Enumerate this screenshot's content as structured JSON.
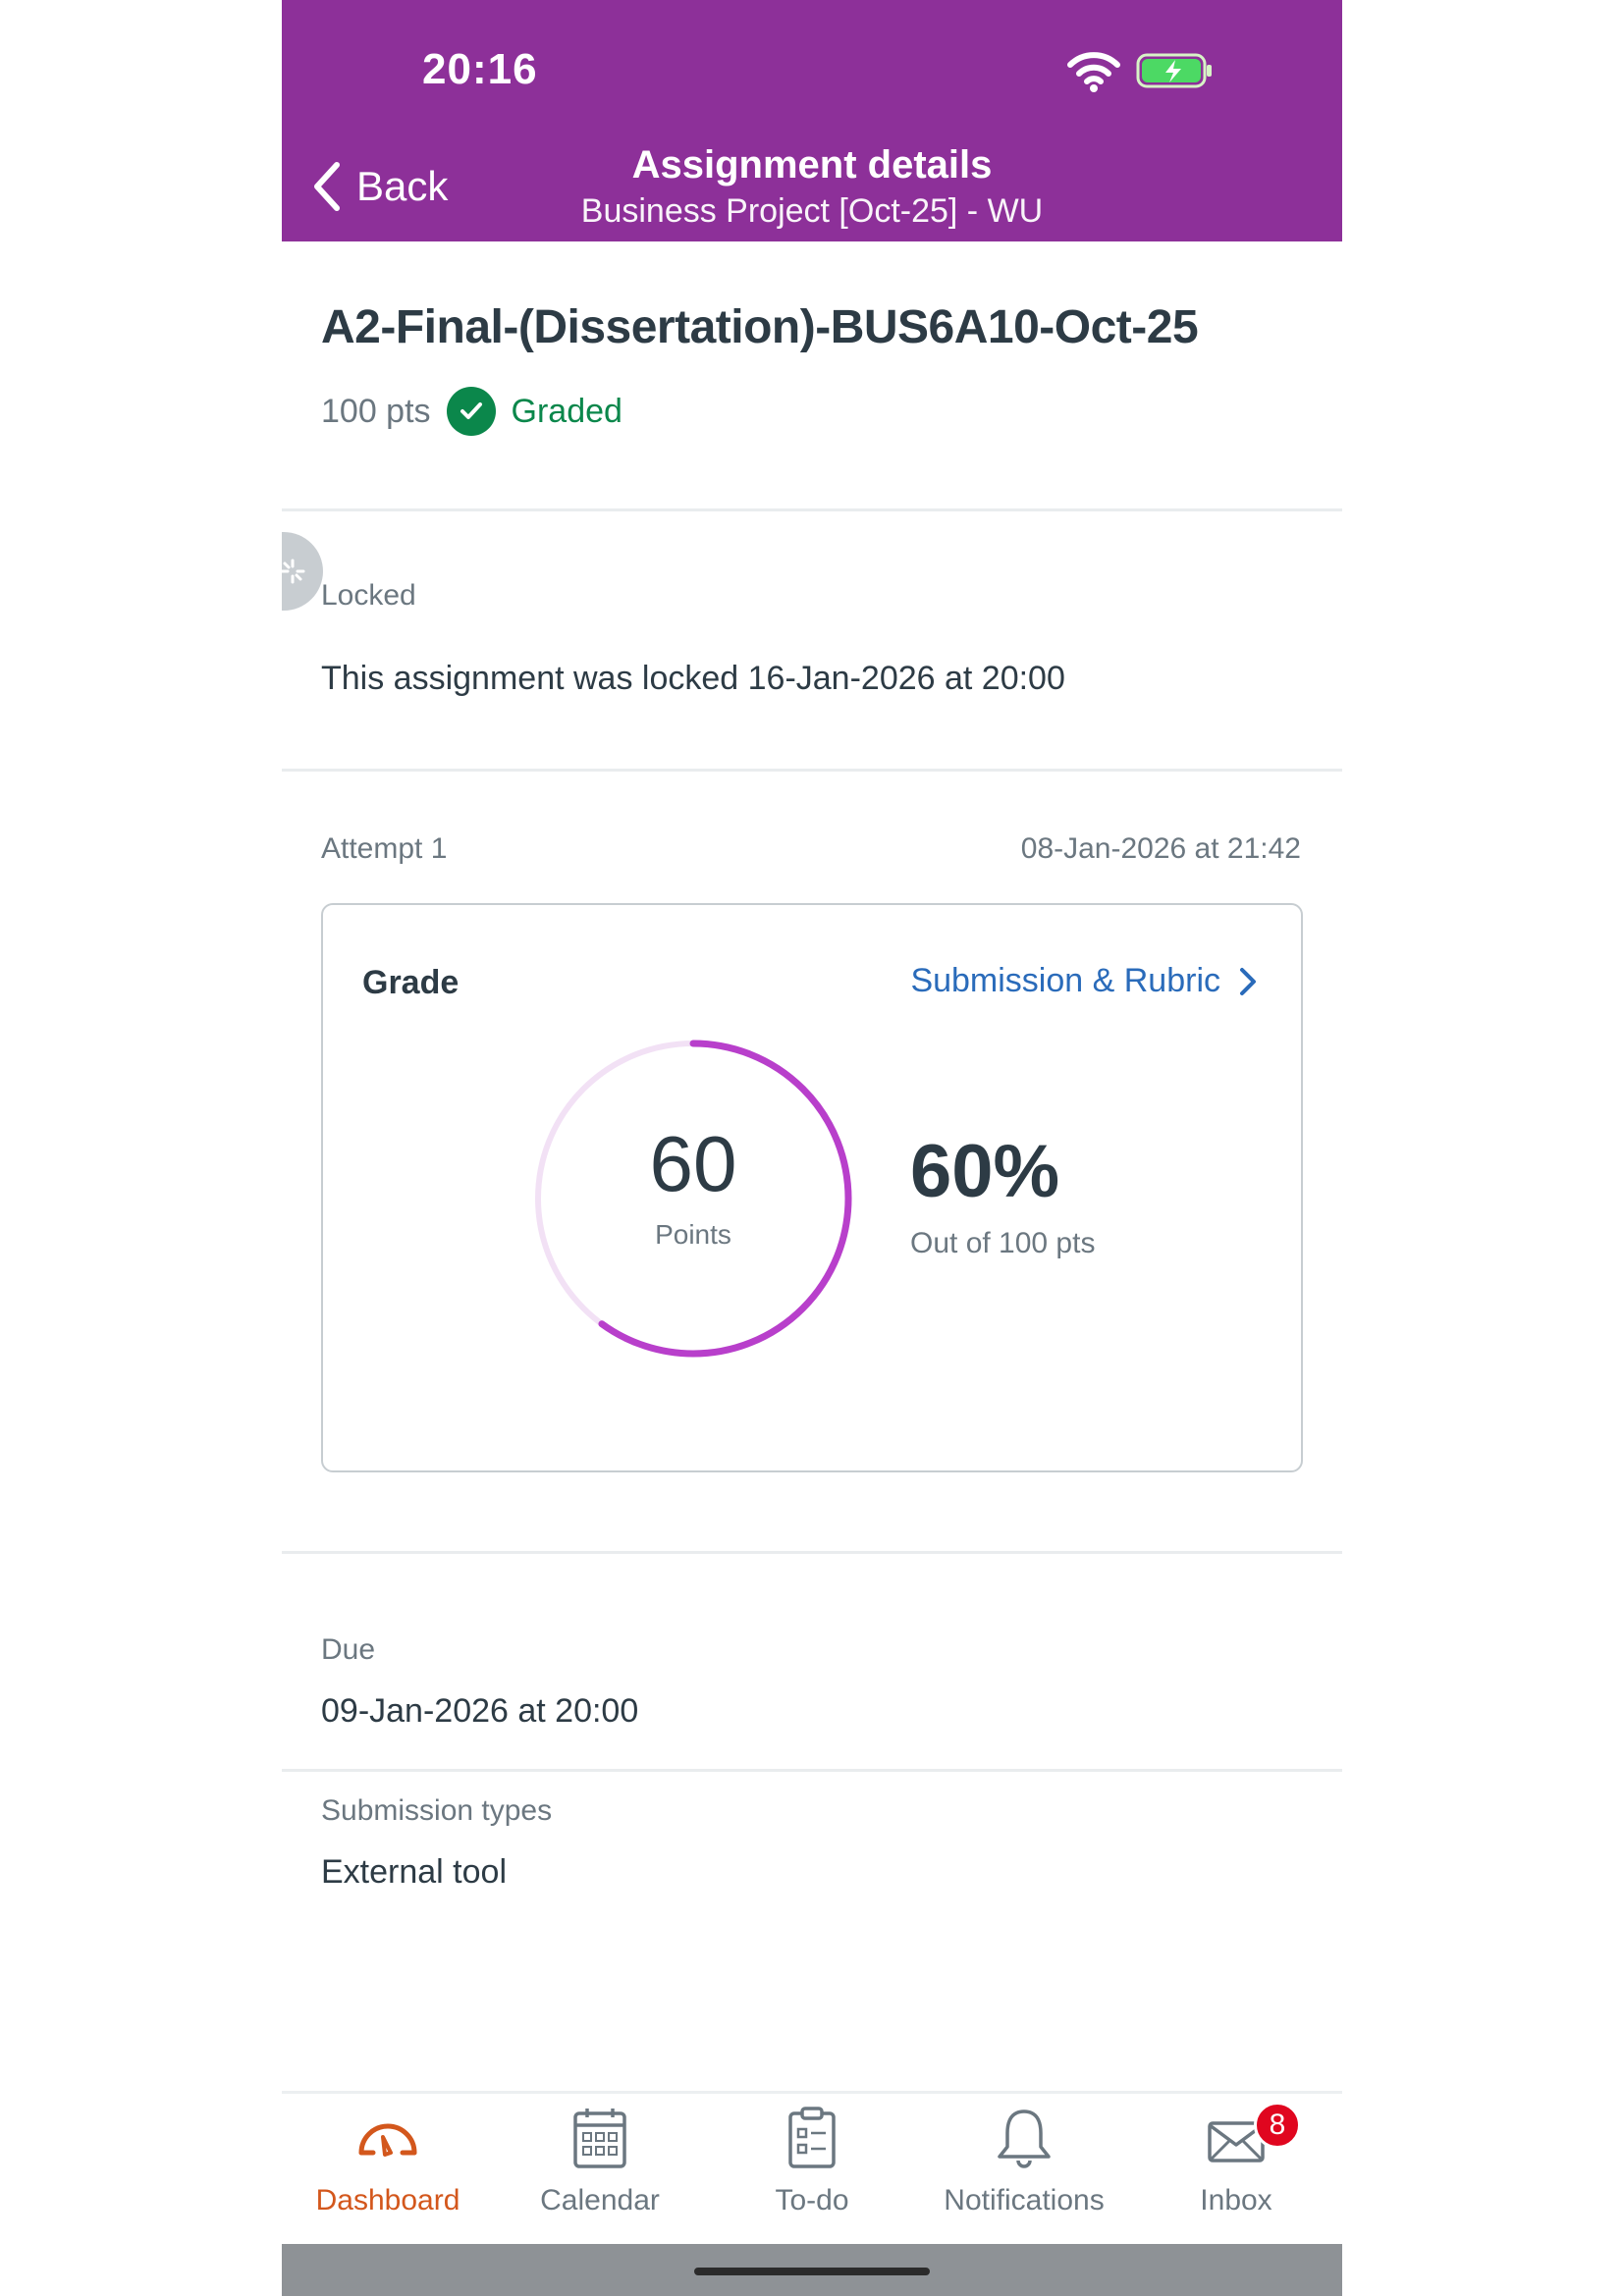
{
  "status_bar": {
    "time": "20:16"
  },
  "header": {
    "back_label": "Back",
    "title": "Assignment details",
    "subtitle": "Business Project [Oct-25] - WU",
    "bg_color": "#8d3099"
  },
  "assignment": {
    "title": "A2-Final-(Dissertation)-BUS6A10-Oct-25",
    "points": "100 pts",
    "status": "Graded"
  },
  "lock": {
    "label": "Locked",
    "text": "This assignment was locked 16-Jan-2026 at 20:00"
  },
  "attempt": {
    "label": "Attempt 1",
    "date": "08-Jan-2026 at 21:42"
  },
  "grade_card": {
    "label": "Grade",
    "link": "Submission & Rubric",
    "points_value": "60",
    "points_label": "Points",
    "percent": "60%",
    "out_of": "Out of 100 pts",
    "score_fraction": 0.6
  },
  "due": {
    "label": "Due",
    "value": "09-Jan-2026 at 20:00"
  },
  "submission_types": {
    "label": "Submission types",
    "value": "External tool"
  },
  "tabbar": {
    "items": [
      {
        "label": "Dashboard",
        "icon": "dashboard-icon",
        "active": true
      },
      {
        "label": "Calendar",
        "icon": "calendar-icon",
        "active": false
      },
      {
        "label": "To-do",
        "icon": "todo-icon",
        "active": false
      },
      {
        "label": "Notifications",
        "icon": "bell-icon",
        "active": false
      },
      {
        "label": "Inbox",
        "icon": "inbox-icon",
        "active": false,
        "badge": "8"
      }
    ]
  },
  "colors": {
    "accent_active": "#d3571c",
    "link": "#2a6bba",
    "graded": "#0b874b",
    "ring": "#b83fcb",
    "badge": "#e0061f"
  }
}
